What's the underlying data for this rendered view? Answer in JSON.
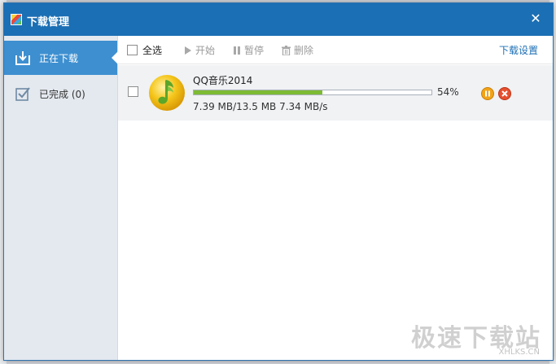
{
  "window": {
    "title": "下载管理",
    "close_glyph": "✕"
  },
  "sidebar": {
    "items": [
      {
        "label": "正在下载",
        "icon": "download-tray-icon",
        "active": true
      },
      {
        "label": "已完成 (0)",
        "icon": "checkbox-check-icon",
        "active": false
      }
    ]
  },
  "toolbar": {
    "select_all": "全选",
    "start": "开始",
    "pause": "暂停",
    "delete": "删除",
    "settings": "下载设置"
  },
  "downloads": [
    {
      "name": "QQ音乐2014",
      "progress_percent": 54,
      "progress_label": "54%",
      "stats": "7.39 MB/13.5 MB 7.34 MB/s",
      "icon": "qq-music-logo"
    }
  ],
  "watermark": {
    "text": "极速下载站",
    "sub": "XHLKS.CN"
  },
  "colors": {
    "titlebar": "#1b6fb4",
    "active_nav": "#3d8fd0",
    "progress": "#7dbb34",
    "link": "#1c6fb5"
  }
}
